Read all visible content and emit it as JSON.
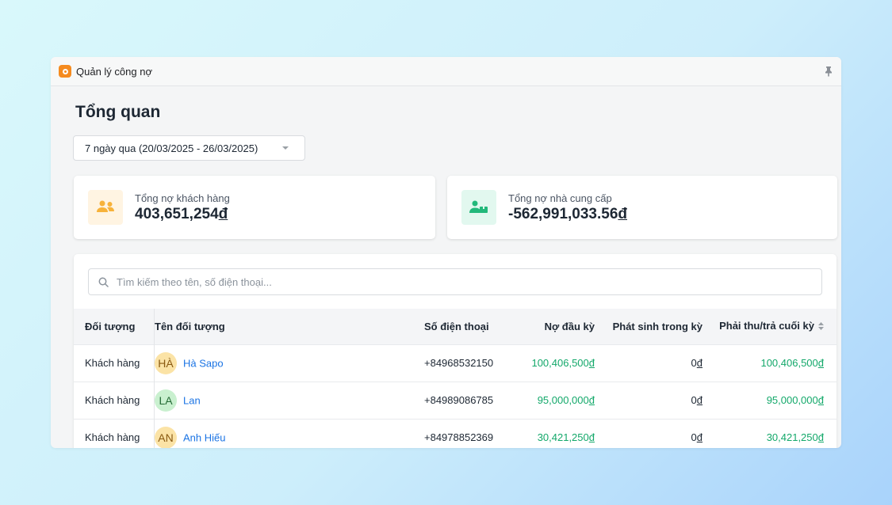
{
  "window": {
    "title": "Quản lý công nợ"
  },
  "page": {
    "title": "Tổng quan"
  },
  "date_filter": {
    "value": "7 ngày qua (20/03/2025 - 26/03/2025)"
  },
  "cards": [
    {
      "label": "Tổng nợ khách hàng",
      "amount": "403,651,254",
      "currency": "đ",
      "icon": "customers-icon"
    },
    {
      "label": "Tổng nợ nhà cung cấp",
      "amount": "-562,991,033.56",
      "currency": "đ",
      "icon": "supplier-icon"
    }
  ],
  "search": {
    "placeholder": "Tìm kiếm theo tên, số điện thoại..."
  },
  "table": {
    "headers": {
      "type": "Đối tượng",
      "name": "Tên đối tượng",
      "phone": "Số điện thoại",
      "opening": "Nợ đầu kỳ",
      "incurred": "Phát sinh trong kỳ",
      "closing": "Phải thu/trả cuối kỳ"
    },
    "rows": [
      {
        "type": "Khách hàng",
        "initials": "HÀ",
        "name": "Hà Sapo",
        "phone": "+84968532150",
        "opening": "100,406,500",
        "incurred": "0",
        "closing": "100,406,500",
        "currency": "đ"
      },
      {
        "type": "Khách hàng",
        "initials": "LA",
        "name": "Lan",
        "phone": "+84989086785",
        "opening": "95,000,000",
        "incurred": "0",
        "closing": "95,000,000",
        "currency": "đ"
      },
      {
        "type": "Khách hàng",
        "initials": "AN",
        "name": "Anh Hiếu",
        "phone": "+84978852369",
        "opening": "30,421,250",
        "incurred": "0",
        "closing": "30,421,250",
        "currency": "đ"
      }
    ]
  },
  "colors": {
    "accent": "#1b74e4",
    "positive": "#13a86a",
    "brand": "#f58b1f"
  }
}
